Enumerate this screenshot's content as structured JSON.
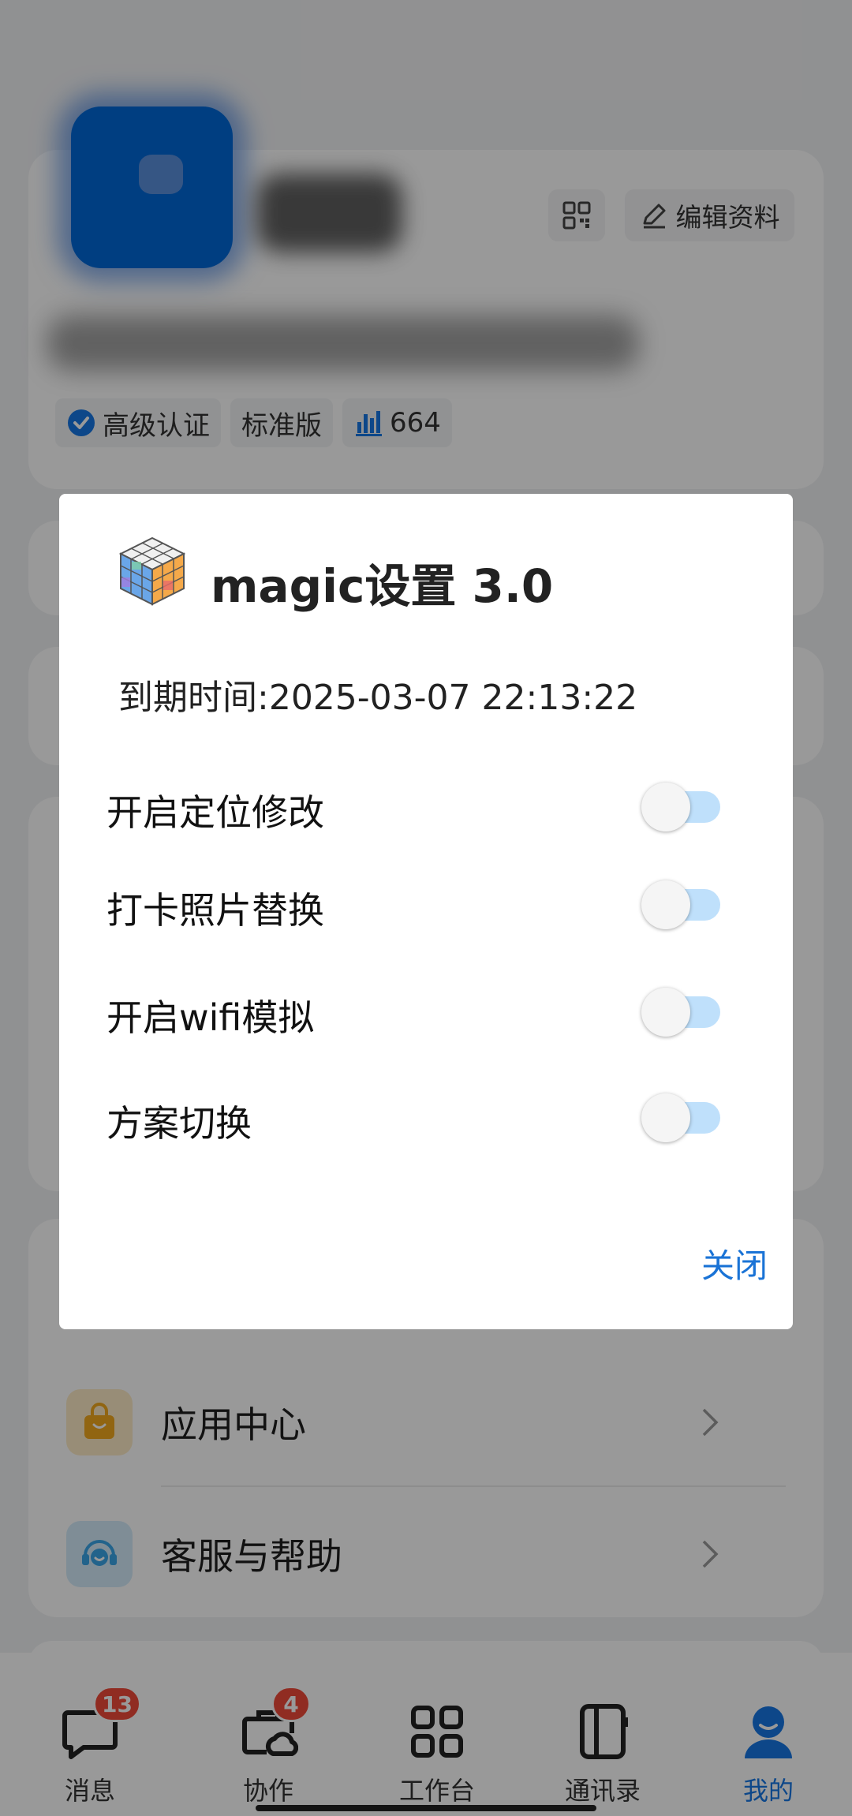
{
  "profile": {
    "edit_label": "编辑资料",
    "tags": [
      {
        "label": "高级认证",
        "icon": "verified-check-icon"
      },
      {
        "label": "标准版"
      },
      {
        "label": "664",
        "icon": "bar-chart-icon"
      }
    ]
  },
  "menu": {
    "items": [
      {
        "label": "应用中心",
        "icon": "shopping-bag-icon",
        "icon_color": "#f2a81d"
      },
      {
        "label": "客服与帮助",
        "icon": "headset-icon",
        "icon_color": "#3aa5e8"
      }
    ]
  },
  "bottom_nav": [
    {
      "label": "消息",
      "icon": "chat-bubble-icon",
      "badge": "13"
    },
    {
      "label": "协作",
      "icon": "briefcase-cloud-icon",
      "badge": "4"
    },
    {
      "label": "工作台",
      "icon": "grid-icon"
    },
    {
      "label": "通讯录",
      "icon": "contacts-book-icon"
    },
    {
      "label": "我的",
      "icon": "person-icon",
      "active": true
    }
  ],
  "dialog": {
    "title": "magic设置 3.0",
    "expiry_text": "到期时间:2025-03-07 22:13:22",
    "toggles": [
      {
        "label": "开启定位修改",
        "on": false
      },
      {
        "label": "打卡照片替换",
        "on": false
      },
      {
        "label": "开启wifi模拟",
        "on": false
      },
      {
        "label": "方案切换",
        "on": false
      }
    ],
    "close_label": "关闭"
  },
  "colors": {
    "accent": "#1677e5",
    "badge": "#f04a3a",
    "toggle_track": "#bfe0fb",
    "close_text": "#1a73d6"
  }
}
